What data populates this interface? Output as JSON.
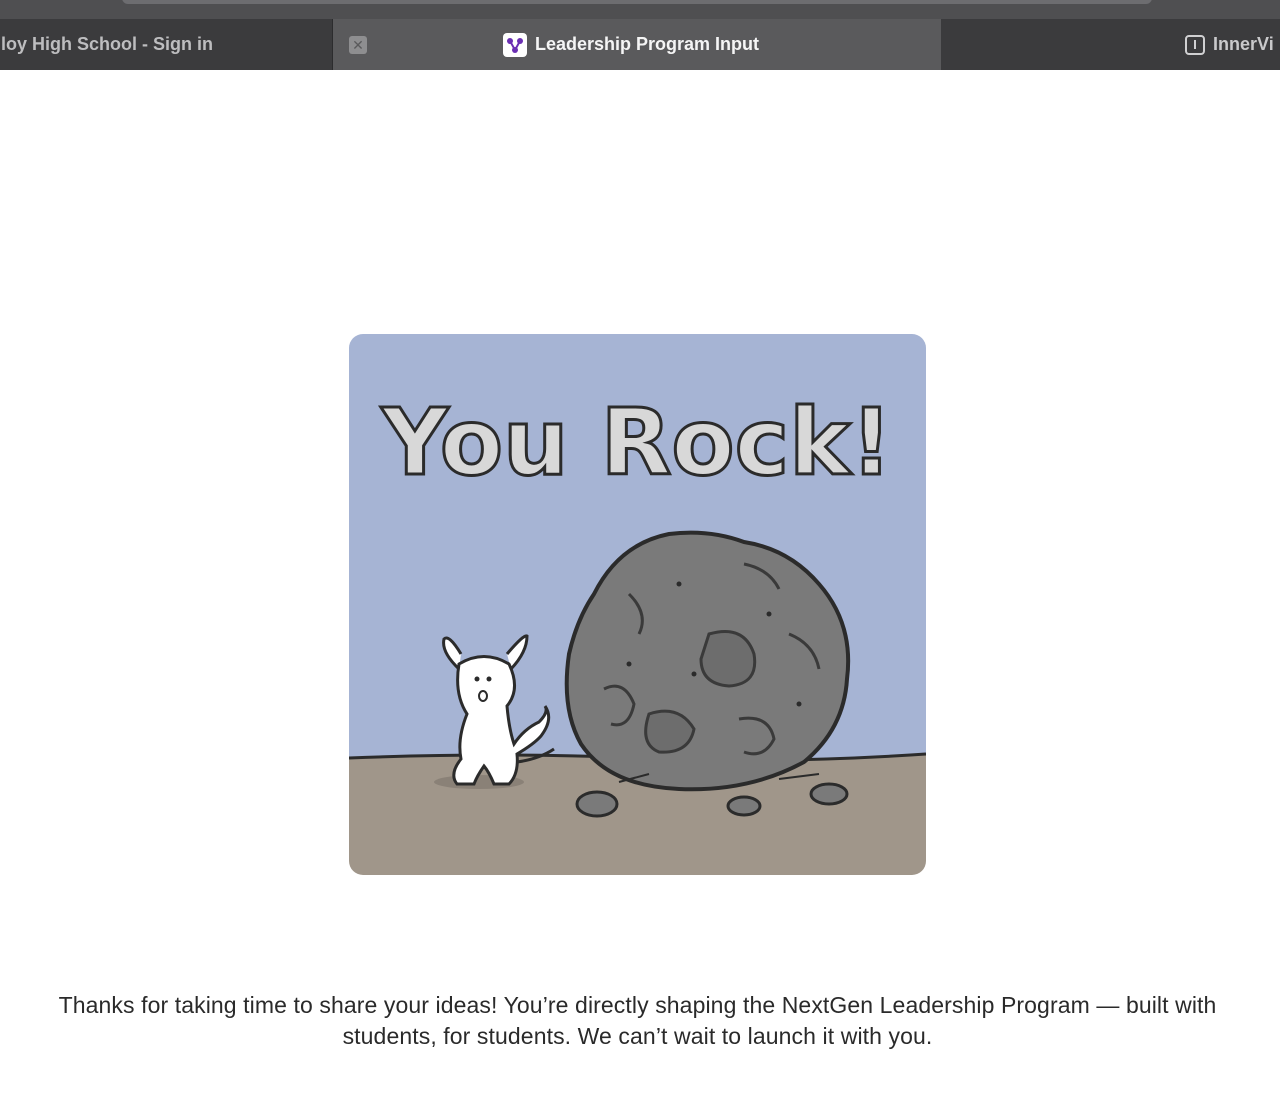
{
  "browser": {
    "tabs": [
      {
        "title": "lloy High School - Sign in",
        "active": false
      },
      {
        "title": "Leadership Program Input",
        "active": true,
        "close_glyph": "✕"
      },
      {
        "title": "InnerVi",
        "active": false
      }
    ]
  },
  "main": {
    "image": {
      "caption_text": "You Rock!",
      "icon": "you-rock-illustration"
    },
    "message": "Thanks for taking  time to share your ideas! You’re directly shaping the NextGen Leadership Program — built with students, for students. We can’t wait to launch it with you."
  },
  "colors": {
    "tabbar": "#3d3d3f",
    "active_tab": "#5a5a5c",
    "favicon_purple": "#6b2fb3",
    "sky": "#a6b4d4",
    "ground": "#a0968a",
    "rock": "#7a7a7a"
  }
}
